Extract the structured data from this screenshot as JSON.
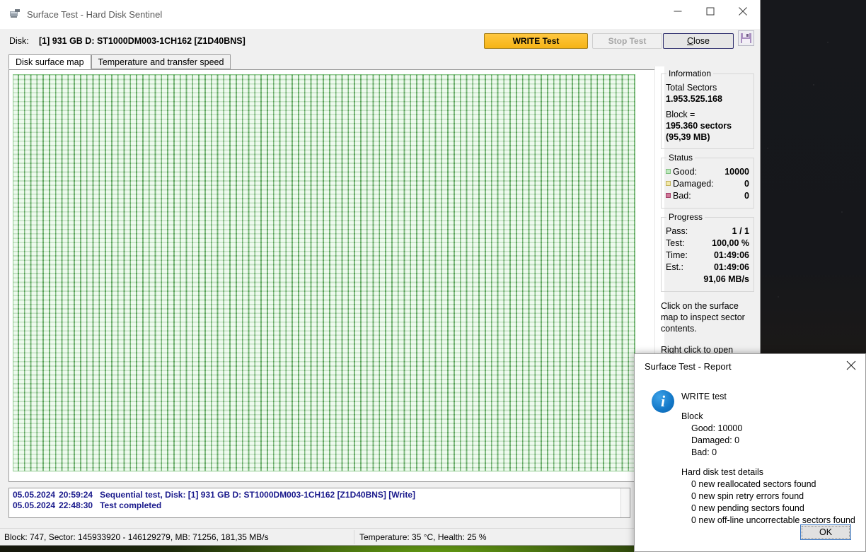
{
  "window": {
    "title": "Surface Test - Hard Disk Sentinel",
    "icon": "disk-window-icon",
    "minimize": "minimize-icon",
    "maximize": "maximize-icon",
    "close": "close-icon"
  },
  "disk": {
    "label": "Disk:",
    "value": "[1] 931 GB D: ST1000DM003-1CH162 [Z1D40BNS]"
  },
  "toolbar": {
    "write_test": "WRITE Test",
    "stop_test": "Stop Test",
    "close": "Close",
    "close_accesskey": "C",
    "save_icon": "floppy-save-icon"
  },
  "tabs": [
    {
      "label": "Disk surface map",
      "active": true
    },
    {
      "label": "Temperature and transfer speed",
      "active": false
    }
  ],
  "information": {
    "legend": "Information",
    "total_sectors_label": "Total Sectors",
    "total_sectors_value": "1.953.525.168",
    "block_label": "Block =",
    "block_value": "195.360 sectors",
    "block_size": "(95,39 MB)"
  },
  "status": {
    "legend": "Status",
    "rows": [
      {
        "key": "Good:",
        "value": "10000",
        "swatch": "#bfe9bf"
      },
      {
        "key": "Damaged:",
        "value": "0",
        "swatch": "#f2e8a8"
      },
      {
        "key": "Bad:",
        "value": "0",
        "swatch": "#d07898"
      }
    ]
  },
  "progress": {
    "legend": "Progress",
    "rows": [
      {
        "key": "Pass:",
        "value": "1 / 1"
      },
      {
        "key": "Test:",
        "value": "100,00 %"
      },
      {
        "key": "Time:",
        "value": "01:49:06"
      },
      {
        "key": "Est.:",
        "value": "01:49:06"
      }
    ],
    "speed": "91,06 MB/s"
  },
  "hints": {
    "click_hint": "Click on the surface map to inspect sector contents.",
    "right_click_hint": "Right click to open"
  },
  "log": [
    {
      "date": "05.05.2024",
      "time": "20:59:24",
      "text": "Sequential test, Disk: [1] 931 GB D: ST1000DM003-1CH162 [Z1D40BNS] [Write]"
    },
    {
      "date": "05.05.2024",
      "time": "22:48:30",
      "text": "Test completed"
    }
  ],
  "statusbar": {
    "left": "Block: 747, Sector: 145933920 - 146129279, MB: 71256, 181,35 MB/s",
    "right": "Temperature: 35  °C,  Health: 25 %"
  },
  "report": {
    "title": "Surface Test - Report",
    "close_icon": "close-icon",
    "info_icon": "info-icon",
    "info_glyph": "i",
    "heading": "WRITE test",
    "block_heading": "Block",
    "block_lines": [
      "Good: 10000",
      "Damaged: 0",
      "Bad: 0"
    ],
    "details_heading": "Hard disk test details",
    "detail_lines": [
      "0 new reallocated sectors found",
      "0 new spin retry errors found",
      "0 new pending sectors found",
      "0 new off-line uncorrectable sectors found"
    ],
    "ok": "OK"
  },
  "surface_map": {
    "cell_good_color": "#a9e5a9",
    "grid_line_color": "#3c8c3c",
    "columns": 100,
    "rows": 90
  }
}
